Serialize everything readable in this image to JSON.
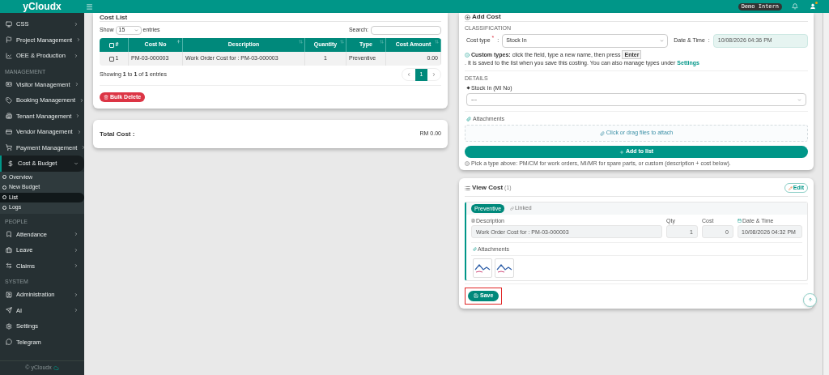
{
  "topbar": {
    "brand": "yCloudx",
    "user_badge": "Demo Intern",
    "notification_dot": true
  },
  "sidebar": {
    "groups": [
      {
        "items": [
          {
            "label": "CSS",
            "kind": "group",
            "expanded": false
          },
          {
            "label": "Project Management",
            "kind": "group",
            "expanded": false
          },
          {
            "label": "OEE & Production",
            "kind": "group",
            "expanded": false
          }
        ]
      },
      {
        "heading": "MANAGEMENT",
        "items": [
          {
            "label": "Visitor Management",
            "kind": "group",
            "expanded": false
          },
          {
            "label": "Booking Management",
            "kind": "group",
            "expanded": false
          },
          {
            "label": "Tenant Management",
            "kind": "group",
            "expanded": false
          },
          {
            "label": "Vendor Management",
            "kind": "group",
            "expanded": false
          },
          {
            "label": "Payment Management",
            "kind": "group",
            "expanded": false
          },
          {
            "label": "Cost & Budget",
            "kind": "group",
            "expanded": true,
            "children": [
              {
                "label": "Overview",
                "selected": false
              },
              {
                "label": "New Budget",
                "selected": false
              },
              {
                "label": "List",
                "selected": true
              },
              {
                "label": "Logs",
                "selected": false
              }
            ]
          }
        ]
      },
      {
        "heading": "PEOPLE",
        "items": [
          {
            "label": "Attendance",
            "kind": "group",
            "expanded": false
          },
          {
            "label": "Leave",
            "kind": "group",
            "expanded": false
          },
          {
            "label": "Claims",
            "kind": "group",
            "expanded": false
          }
        ]
      },
      {
        "heading": "SYSTEM",
        "items": [
          {
            "label": "Administration",
            "kind": "group",
            "expanded": false
          },
          {
            "label": "AI",
            "kind": "group",
            "expanded": false
          },
          {
            "label": "Settings",
            "kind": "link"
          },
          {
            "label": "Telegram",
            "kind": "link"
          }
        ]
      }
    ],
    "footer": "© yCloudx"
  },
  "cost_list": {
    "title": "Cost List",
    "show_label": "Show",
    "page_size": "15",
    "entries_label": "entries",
    "search_label": "Search:",
    "header_checked": false,
    "columns": [
      {
        "label": "#"
      },
      {
        "label": "Cost No",
        "sorted": true
      },
      {
        "label": "Description",
        "sorted": false
      },
      {
        "label": "Quantity",
        "sorted": false
      },
      {
        "label": "Type",
        "sorted": false
      },
      {
        "label": "Cost Amount",
        "sorted": false
      }
    ],
    "rows": [
      {
        "checked": false,
        "cells": [
          "1",
          "PM-03-000003",
          "Work Order Cost for : PM-03-000003",
          "1",
          "Preventive",
          "0.00"
        ]
      }
    ],
    "info": "Showing **1** to **1** of **1** entries",
    "pages": [
      {
        "label": "1",
        "selected": true
      }
    ],
    "bulk_delete": "Bulk Delete"
  },
  "total": {
    "label": "Total Cost :",
    "value": "RM 0.00"
  },
  "add_cost": {
    "title": "Add Cost",
    "classification_heading": "CLASSIFICATION",
    "cost_type_label": "Cost type",
    "required_mark": "*",
    "separator": ":",
    "cost_type_value": "Stock In",
    "datetime_label": "Date & Time",
    "datetime_value": "10/08/2026 04:36 PM",
    "hint": {
      "prefix": "Custom types:",
      "text_before": "click the field, type a new name, then press",
      "key": "Enter",
      "text_after": ". It is saved to the list when you save this costing. You can also manage types under",
      "link": "Settings"
    },
    "details_heading": "DETAILS",
    "stock_label": "Stock In (MI No)",
    "stock_value": "---",
    "attachments_label": "Attachments",
    "dropzone": "Click or drag files to attach",
    "add_button": "Add to list",
    "footnote": "Pick a type above: PM/CM for work orders, MI/MR for spare parts, or custom (description + cost below)."
  },
  "view_cost": {
    "title": "View Cost",
    "count": "(1)",
    "edit_button": "Edit",
    "type_badge": "Preventive",
    "linked_label": "Linked",
    "description_label": "Description",
    "description_value": "Work Order Cost for : PM-03-000003",
    "qty_label": "Qty",
    "qty_value": "1",
    "cost_label": "Cost",
    "cost_value": "0",
    "datetime_label": "Date & Time",
    "datetime_value": "10/08/2026 04:32 PM",
    "attachments_label": "Attachments",
    "attachments": [
      {
        "kind": "image"
      },
      {
        "kind": "image"
      }
    ],
    "save_button": {
      "label": "Save",
      "highlighted": true
    }
  }
}
